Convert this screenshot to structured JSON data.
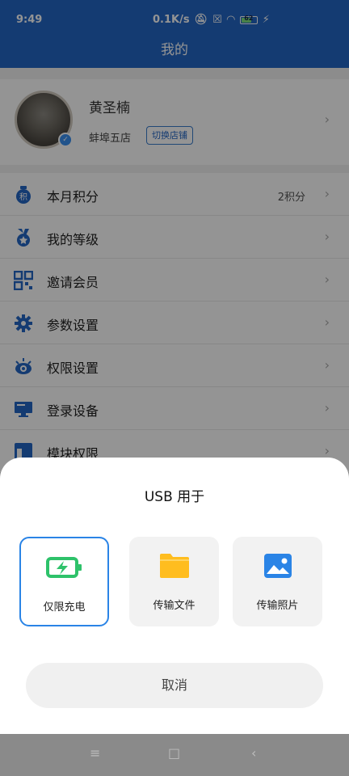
{
  "status": {
    "time": "9:49",
    "net_speed": "0.1K/s",
    "battery": "62"
  },
  "header": {
    "title": "我的"
  },
  "profile": {
    "name": "黄圣楠",
    "store": "蚌埠五店",
    "switch_label": "切换店铺"
  },
  "menu": [
    {
      "label": "本月积分",
      "value": "2积分",
      "icon": "points-icon"
    },
    {
      "label": "我的等级",
      "value": "",
      "icon": "medal-icon"
    },
    {
      "label": "邀请会员",
      "value": "",
      "icon": "qrcode-icon"
    },
    {
      "label": "参数设置",
      "value": "",
      "icon": "gear-icon"
    },
    {
      "label": "权限设置",
      "value": "",
      "icon": "eye-icon"
    },
    {
      "label": "登录设备",
      "value": "",
      "icon": "monitor-icon"
    },
    {
      "label": "模块权限",
      "value": "",
      "icon": "module-icon"
    }
  ],
  "usb_sheet": {
    "title": "USB 用于",
    "options": [
      {
        "label": "仅限充电",
        "icon": "battery-charge-icon",
        "selected": true
      },
      {
        "label": "传输文件",
        "icon": "folder-icon",
        "selected": false
      },
      {
        "label": "传输照片",
        "icon": "image-icon",
        "selected": false
      }
    ],
    "cancel_label": "取消"
  },
  "colors": {
    "brand": "#2466c5",
    "accent": "#2a84e6"
  }
}
